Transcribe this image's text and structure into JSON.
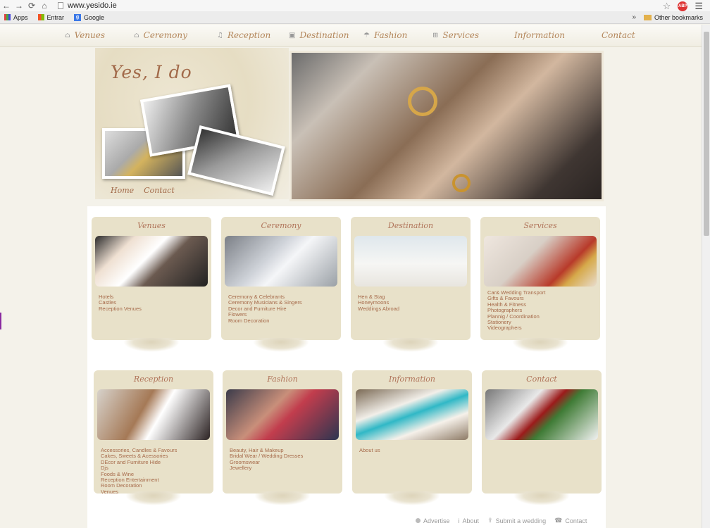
{
  "browser": {
    "url": "www.yesido.ie",
    "abp_label": "ABP",
    "bookmarks": [
      {
        "label": "Apps"
      },
      {
        "label": "Entrar"
      },
      {
        "label": "Google"
      }
    ],
    "bookmarks_overflow": "»",
    "other_bookmarks": "Other bookmarks"
  },
  "nav": {
    "items": [
      {
        "label": "Venues"
      },
      {
        "label": "Ceremony"
      },
      {
        "label": "Reception"
      },
      {
        "label": "Destination"
      },
      {
        "label": "Fashion"
      },
      {
        "label": "Services"
      },
      {
        "label": "Information"
      },
      {
        "label": "Contact"
      }
    ]
  },
  "header": {
    "title": "Yes, I do",
    "links": [
      {
        "label": "Home"
      },
      {
        "label": "Contact"
      }
    ]
  },
  "cards": [
    {
      "title": "Venues",
      "links": [
        "Hotels",
        "Castles",
        "Reception Venues"
      ]
    },
    {
      "title": "Ceremony",
      "links": [
        "Ceremony & Celebrants",
        "Ceremony Musicians & Singers",
        "Decor and Furniture Hire",
        "Flowers",
        "Room Decoration"
      ]
    },
    {
      "title": "Destination",
      "links": [
        "Hen & Stag",
        "Honeymoons",
        "Weddings Abroad"
      ]
    },
    {
      "title": "Services",
      "links": [
        "Car& Wedding Transport",
        "Gifts & Favours",
        "Health & Fitness",
        "Photographers",
        "Plannig / Coordination",
        "Stationery",
        "Videographers"
      ]
    },
    {
      "title": "Reception",
      "links": [
        "Accessories, Candles & Favours",
        "Cakes, Sweets & Acessories",
        "DEcor and Furniture Hide",
        "Djs",
        "Foods & Wine",
        "Reception Entertainment",
        "Room Decoration",
        "Venues"
      ]
    },
    {
      "title": "Fashion",
      "links": [
        "Beauty, Hair & Makeup",
        "Bridal Wear / Wedding Dresses",
        "Groomswear",
        "Jewellery"
      ]
    },
    {
      "title": "Information",
      "links": [
        "About us"
      ]
    },
    {
      "title": "Contact",
      "links": []
    }
  ],
  "footer": {
    "links": [
      {
        "label": "Advertise"
      },
      {
        "label": "About"
      },
      {
        "label": "Submit a wedding"
      },
      {
        "label": "Contact"
      }
    ]
  }
}
